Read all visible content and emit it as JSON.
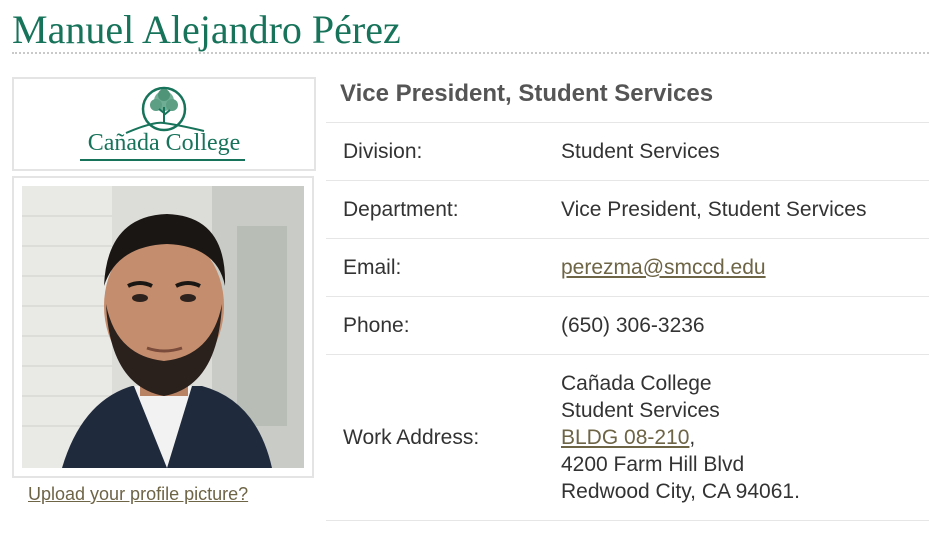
{
  "profile": {
    "name": "Manuel Alejandro Pérez",
    "title": "Vice President, Student Services",
    "upload_link": "Upload your profile picture?"
  },
  "logo": {
    "text": "Cañada College",
    "color": "#17735a"
  },
  "photo": {
    "description_icon": "profile-photo"
  },
  "details": {
    "division_label": "Division:",
    "division_value": "Student Services",
    "department_label": "Department:",
    "department_value": "Vice President, Student Services",
    "email_label": "Email:",
    "email_value": "perezma@smccd.edu",
    "phone_label": "Phone:",
    "phone_value": "(650) 306-3236",
    "address_label": "Work Address:",
    "address": {
      "line1": "Cañada College",
      "line2": "Student Services",
      "building": "BLDG 08-210",
      "building_suffix": ",",
      "line4": "4200 Farm Hill Blvd",
      "line5": "Redwood City, CA 94061."
    }
  },
  "colors": {
    "heading": "#17735a",
    "link": "#6e6446",
    "text": "#333333",
    "rule": "#e6e6e6"
  }
}
